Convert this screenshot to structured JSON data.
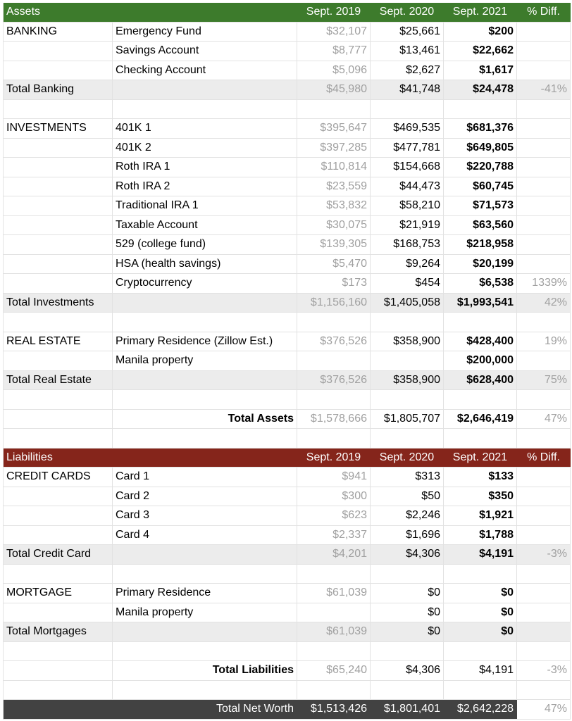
{
  "assets": {
    "header": [
      "Assets",
      "",
      "Sept. 2019",
      "Sept. 2020",
      "Sept. 2021",
      "% Diff."
    ],
    "banking": {
      "rows": [
        [
          "BANKING",
          "Emergency Fund",
          "$32,107",
          "$25,661",
          "$200",
          ""
        ],
        [
          "",
          "Savings Account",
          "$8,777",
          "$13,461",
          "$22,662",
          ""
        ],
        [
          "",
          "Checking Account",
          "$5,096",
          "$2,627",
          "$1,617",
          ""
        ]
      ],
      "total": [
        "Total Banking",
        "",
        "$45,980",
        "$41,748",
        "$24,478",
        "-41%"
      ]
    },
    "investments": {
      "rows": [
        [
          "INVESTMENTS",
          "401K 1",
          "$395,647",
          "$469,535",
          "$681,376",
          ""
        ],
        [
          "",
          "401K 2",
          "$397,285",
          "$477,781",
          "$649,805",
          ""
        ],
        [
          "",
          "Roth IRA 1",
          "$110,814",
          "$154,668",
          "$220,788",
          ""
        ],
        [
          "",
          "Roth IRA 2",
          "$23,559",
          "$44,473",
          "$60,745",
          ""
        ],
        [
          "",
          "Traditional IRA 1",
          "$53,832",
          "$58,210",
          "$71,573",
          ""
        ],
        [
          "",
          "Taxable Account",
          "$30,075",
          "$21,919",
          "$63,560",
          ""
        ],
        [
          "",
          "529 (college fund)",
          "$139,305",
          "$168,753",
          "$218,958",
          ""
        ],
        [
          "",
          "HSA (health savings)",
          "$5,470",
          "$9,264",
          "$20,199",
          ""
        ],
        [
          "",
          "Cryptocurrency",
          "$173",
          "$454",
          "$6,538",
          "1339%"
        ]
      ],
      "total": [
        "Total Investments",
        "",
        "$1,156,160",
        "$1,405,058",
        "$1,993,541",
        "42%"
      ]
    },
    "real_estate": {
      "rows": [
        [
          "REAL ESTATE",
          "Primary Residence (Zillow Est.)",
          "$376,526",
          "$358,900",
          "$428,400",
          "19%"
        ],
        [
          "",
          "Manila property",
          "",
          "",
          "$200,000",
          ""
        ]
      ],
      "total": [
        "Total Real Estate",
        "",
        "$376,526",
        "$358,900",
        "$628,400",
        "75%"
      ]
    },
    "total_assets": [
      "",
      "Total Assets",
      "$1,578,666",
      "$1,805,707",
      "$2,646,419",
      "47%"
    ]
  },
  "liabilities": {
    "header": [
      "Liabilities",
      "",
      "Sept. 2019",
      "Sept. 2020",
      "Sept. 2021",
      "% Diff."
    ],
    "credit_cards": {
      "rows": [
        [
          "CREDIT CARDS",
          "Card 1",
          "$941",
          "$313",
          "$133",
          ""
        ],
        [
          "",
          "Card 2",
          "$300",
          "$50",
          "$350",
          ""
        ],
        [
          "",
          "Card 3",
          "$623",
          "$2,246",
          "$1,921",
          ""
        ],
        [
          "",
          "Card 4",
          "$2,337",
          "$1,696",
          "$1,788",
          ""
        ]
      ],
      "total": [
        "Total Credit Card",
        "",
        "$4,201",
        "$4,306",
        "$4,191",
        "-3%"
      ]
    },
    "mortgage": {
      "rows": [
        [
          "MORTGAGE",
          "Primary Residence",
          "$61,039",
          "$0",
          "$0",
          ""
        ],
        [
          "",
          "Manila property",
          "",
          "$0",
          "$0",
          ""
        ]
      ],
      "total": [
        "Total Mortgages",
        "",
        "$61,039",
        "$0",
        "$0",
        ""
      ]
    },
    "total_liabilities": [
      "",
      "Total Liabilities",
      "$65,240",
      "$4,306",
      "$4,191",
      "-3%"
    ]
  },
  "net_worth": [
    "",
    "Total Net Worth",
    "$1,513,426",
    "$1,801,401",
    "$2,642,228",
    "47%"
  ]
}
